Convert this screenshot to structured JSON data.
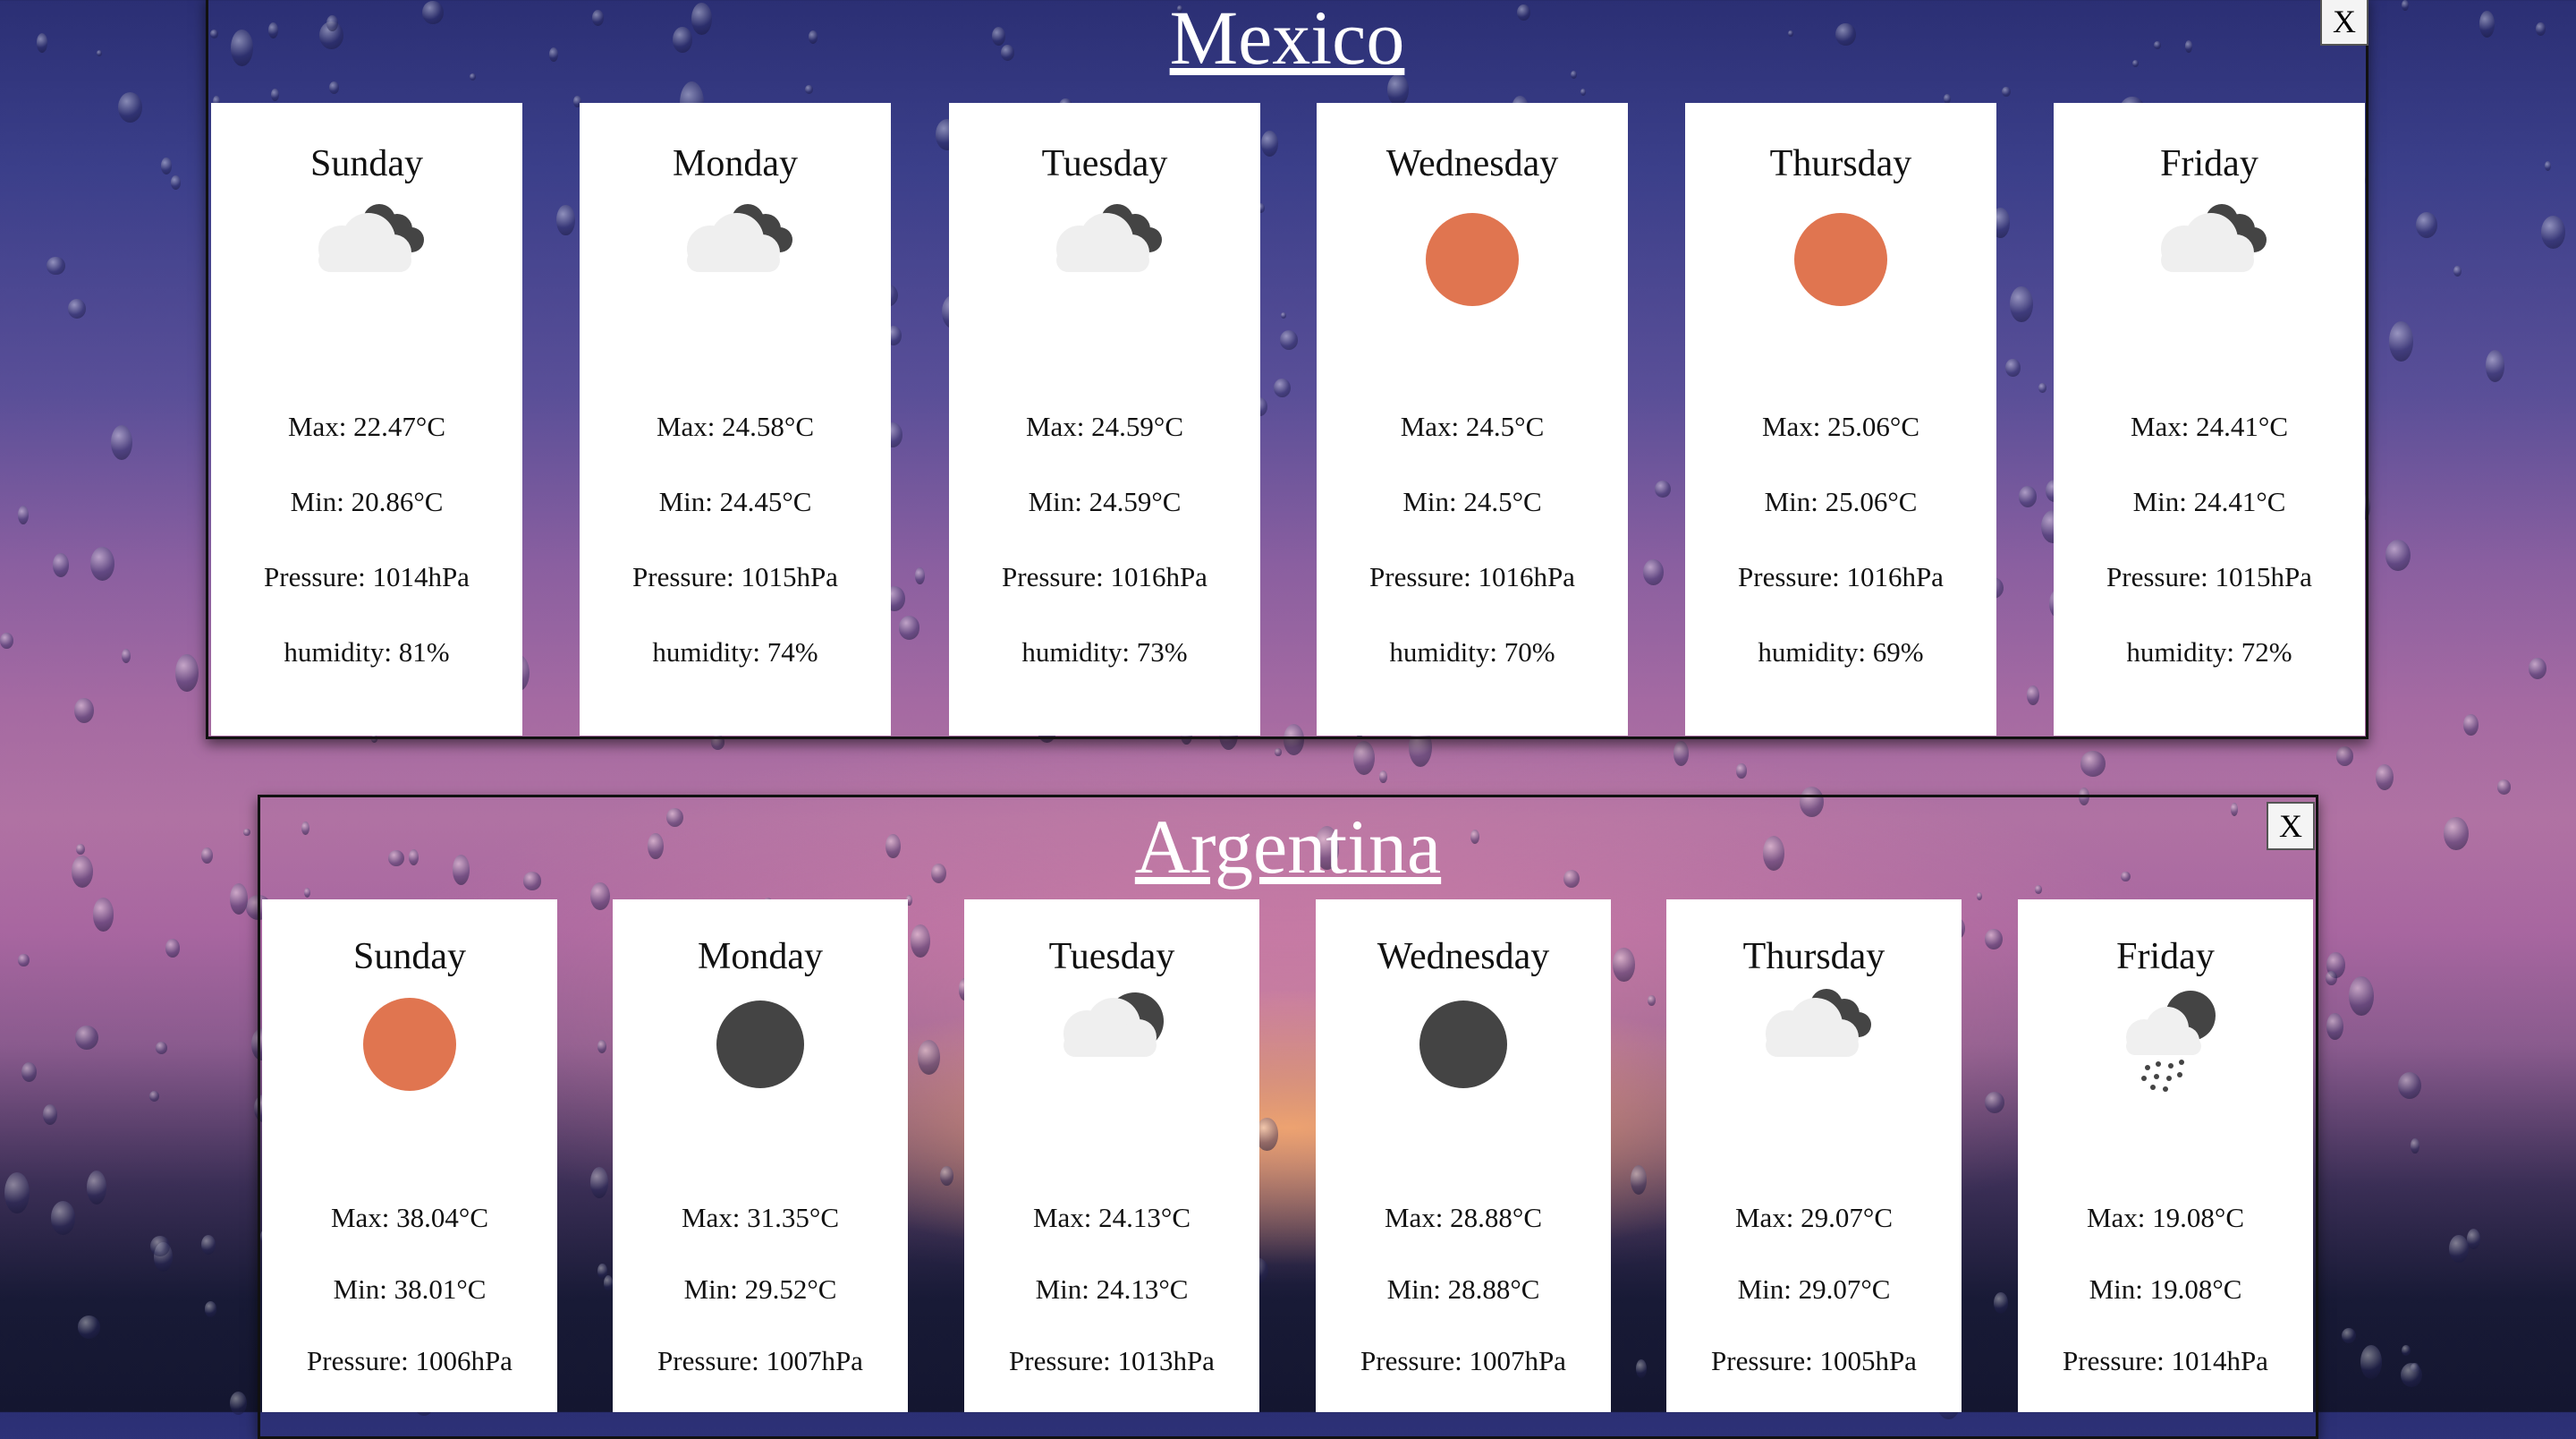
{
  "panels": [
    {
      "title": "Mexico",
      "close_label": "X",
      "days": [
        {
          "day": "Sunday",
          "icon": "partly-cloudy-icon",
          "max": "Max: 22.47°C",
          "min": "Min: 20.86°C",
          "pressure": "Pressure: 1014hPa",
          "humidity": "humidity: 81%"
        },
        {
          "day": "Monday",
          "icon": "partly-cloudy-icon",
          "max": "Max: 24.58°C",
          "min": "Min: 24.45°C",
          "pressure": "Pressure: 1015hPa",
          "humidity": "humidity: 74%"
        },
        {
          "day": "Tuesday",
          "icon": "partly-cloudy-icon",
          "max": "Max: 24.59°C",
          "min": "Min: 24.59°C",
          "pressure": "Pressure: 1016hPa",
          "humidity": "humidity: 73%"
        },
        {
          "day": "Wednesday",
          "icon": "sun-icon",
          "max": "Max: 24.5°C",
          "min": "Min: 24.5°C",
          "pressure": "Pressure: 1016hPa",
          "humidity": "humidity: 70%"
        },
        {
          "day": "Thursday",
          "icon": "sun-icon",
          "max": "Max: 25.06°C",
          "min": "Min: 25.06°C",
          "pressure": "Pressure: 1016hPa",
          "humidity": "humidity: 69%"
        },
        {
          "day": "Friday",
          "icon": "partly-cloudy-icon",
          "max": "Max: 24.41°C",
          "min": "Min: 24.41°C",
          "pressure": "Pressure: 1015hPa",
          "humidity": "humidity: 72%"
        }
      ]
    },
    {
      "title": "Argentina",
      "close_label": "X",
      "days": [
        {
          "day": "Sunday",
          "icon": "sun-icon",
          "max": "Max: 38.04°C",
          "min": "Min: 38.01°C",
          "pressure": "Pressure: 1006hPa"
        },
        {
          "day": "Monday",
          "icon": "moon-icon",
          "max": "Max: 31.35°C",
          "min": "Min: 29.52°C",
          "pressure": "Pressure: 1007hPa"
        },
        {
          "day": "Tuesday",
          "icon": "cloud-moon-icon",
          "max": "Max: 24.13°C",
          "min": "Min: 24.13°C",
          "pressure": "Pressure: 1013hPa"
        },
        {
          "day": "Wednesday",
          "icon": "moon-icon",
          "max": "Max: 28.88°C",
          "min": "Min: 28.88°C",
          "pressure": "Pressure: 1007hPa"
        },
        {
          "day": "Thursday",
          "icon": "partly-cloudy-icon",
          "max": "Max: 29.07°C",
          "min": "Min: 29.07°C",
          "pressure": "Pressure: 1005hPa"
        },
        {
          "day": "Friday",
          "icon": "rain-icon",
          "max": "Max: 19.08°C",
          "min": "Min: 19.08°C",
          "pressure": "Pressure: 1014hPa"
        }
      ]
    }
  ],
  "colors": {
    "sun": "#e07550",
    "moon": "#444444",
    "cloud": "#efefef",
    "dark_cloud": "#444444"
  }
}
